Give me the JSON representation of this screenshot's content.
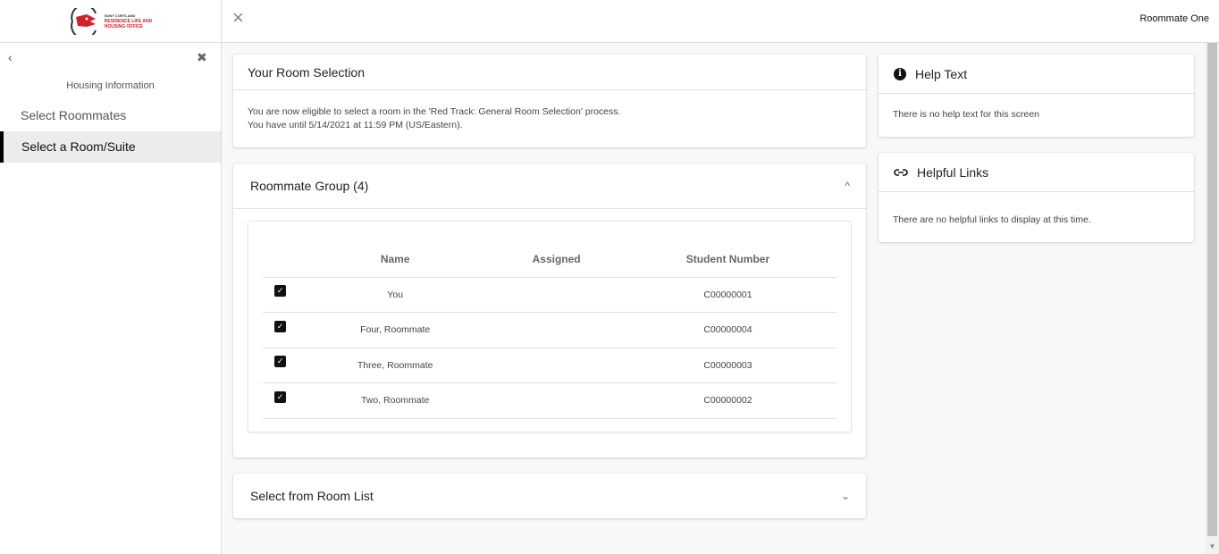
{
  "logo": {
    "line1": "SUNY CORTLAND",
    "line2": "RESIDENCE LIFE AND",
    "line3": "HOUSING OFFICE",
    "brand_color": "#d4202a"
  },
  "sidebar": {
    "back_icon": "‹",
    "close_icon": "✖",
    "heading": "Housing Information",
    "items": [
      {
        "label": "Select Roommates",
        "active": false
      },
      {
        "label": "Select a Room/Suite",
        "active": true
      }
    ]
  },
  "topbar": {
    "close_icon": "×",
    "user_name": "Roommate One"
  },
  "room_selection": {
    "title": "Your Room Selection",
    "line1": "You are now eligible to select a room in the 'Red Track: General Room Selection' process.",
    "line2": "You have until 5/14/2021 at 11:59 PM (US/Eastern)."
  },
  "roommate_group": {
    "title": "Roommate Group (4)",
    "toggle_icon": "^",
    "columns": [
      "Name",
      "Assigned",
      "Student Number"
    ],
    "rows": [
      {
        "checked": true,
        "name": "You",
        "assigned": "",
        "student_number": "C00000001"
      },
      {
        "checked": true,
        "name": "Four, Roommate",
        "assigned": "",
        "student_number": "C00000004"
      },
      {
        "checked": true,
        "name": "Three, Roommate",
        "assigned": "",
        "student_number": "C00000003"
      },
      {
        "checked": true,
        "name": "Two, Roommate",
        "assigned": "",
        "student_number": "C00000002"
      }
    ]
  },
  "room_list": {
    "title": "Select from Room List",
    "toggle_icon": "⌄"
  },
  "help_text": {
    "title": "Help Text",
    "icon": "i",
    "body": "There is no help text for this screen"
  },
  "helpful_links": {
    "title": "Helpful Links",
    "icon": "⊂⊃",
    "body": "There are no helpful links to display at this time."
  },
  "checkmark": "✓"
}
